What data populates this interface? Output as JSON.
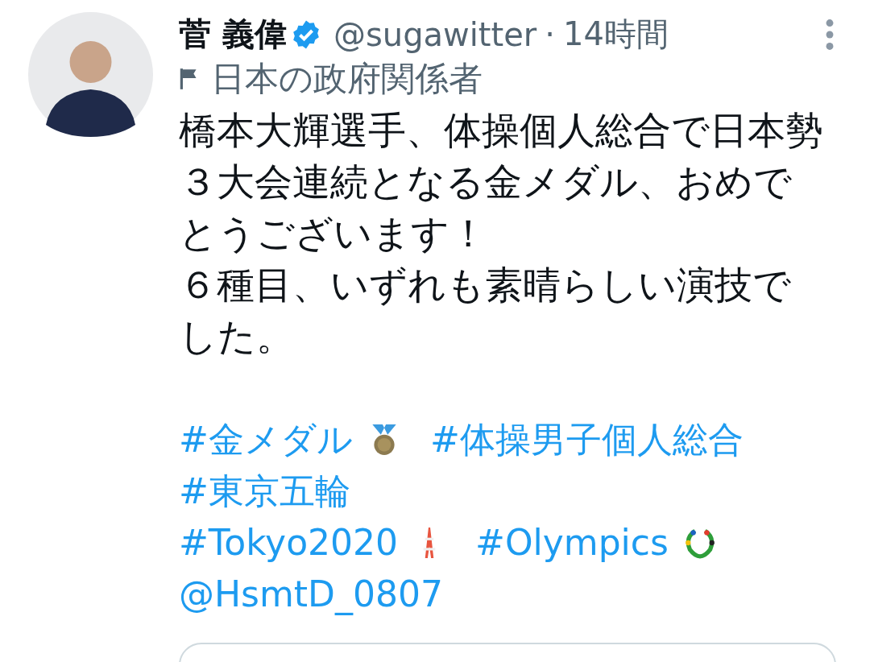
{
  "tweet": {
    "author": {
      "name": "菅 義偉",
      "verified": true,
      "handle": "@sugawitter",
      "separator": "·",
      "time": "14時間",
      "affiliation": "日本の政府関係者"
    },
    "text": [
      "橋本大輝選手、体操個人総合で日本勢３大会連続となる金メダル、おめでとうございます！",
      "６種目、いずれも素晴らしい演技でした。"
    ],
    "tag_lines": [
      [
        {
          "text": "#金メダル",
          "kind": "medal"
        },
        {
          "text": "#体操男子個人総合"
        },
        {
          "text": "#東京五輪"
        }
      ],
      [
        {
          "text": "#Tokyo2020",
          "kind": "tower"
        },
        {
          "text": "#Olympics",
          "kind": "wreath"
        }
      ]
    ],
    "mention": "@HsmtD_0807"
  }
}
